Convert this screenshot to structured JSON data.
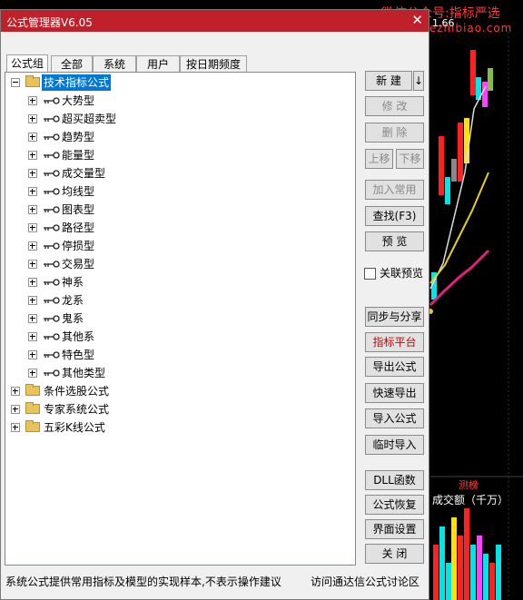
{
  "background": {
    "watermark_line1": "微信公众号:指标严选",
    "watermark_line2": "www.xuezhibiao.com",
    "price_label": "1.66",
    "volume_title": "成交额（千万）",
    "volume_tag": "测榜"
  },
  "dialog": {
    "title": "公式管理器V6.05",
    "close_glyph": "✕",
    "tabs": [
      "公式组",
      "全部",
      "系统",
      "用户",
      "按日期频度"
    ],
    "tree": {
      "root": "技术指标公式",
      "children": [
        "大势型",
        "超买超卖型",
        "趋势型",
        "能量型",
        "成交量型",
        "均线型",
        "图表型",
        "路径型",
        "停损型",
        "交易型",
        "神系",
        "龙系",
        "鬼系",
        "其他系",
        "特色型",
        "其他类型"
      ],
      "groups": [
        "条件选股公式",
        "专家系统公式",
        "五彩K线公式"
      ]
    },
    "buttons": {
      "new": "新  建",
      "new_arrow": "↓",
      "modify": "修  改",
      "delete": "删  除",
      "move_up": "上移",
      "move_down": "下移",
      "add_common": "加入常用",
      "find": "查找(F3)",
      "preview": "预  览",
      "linked_preview": "关联预览",
      "sync_share": "同步与分享",
      "indicator_platform": "指标平台",
      "export_formula": "导出公式",
      "quick_export": "快速导出",
      "import_formula": "导入公式",
      "temp_import": "临时导入",
      "dll_func": "DLL函数",
      "restore": "公式恢复",
      "ui_settings": "界面设置",
      "close": "关  闭"
    },
    "status_left": "系统公式提供常用指标及模型的实现样本,不表示操作建议",
    "status_right": "访问通达信公式讨论区"
  }
}
